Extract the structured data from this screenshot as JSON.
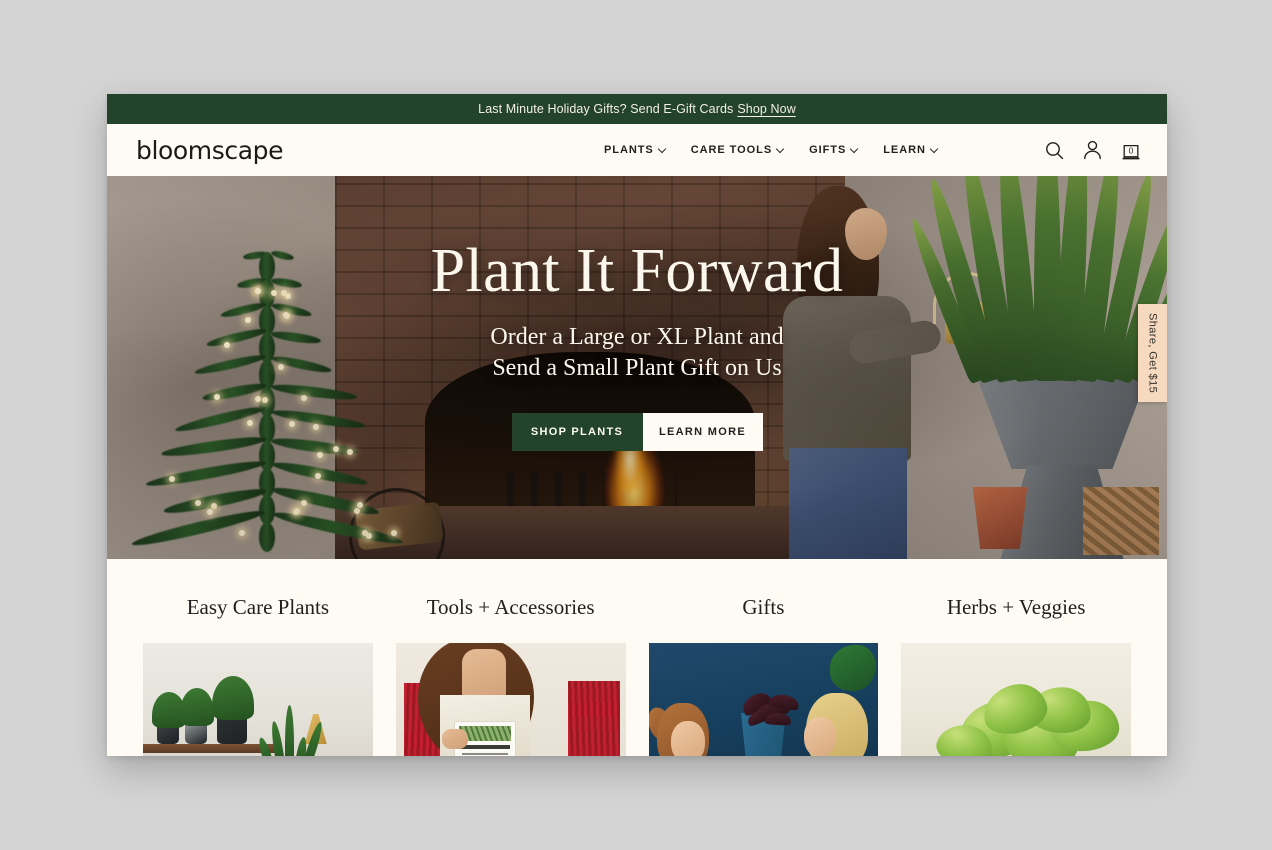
{
  "announcement": {
    "text": "Last Minute Holiday Gifts? Send E-Gift Cards",
    "link_label": "Shop Now"
  },
  "header": {
    "logo": "bloomscape",
    "nav": [
      {
        "label": "PLANTS",
        "has_dropdown": true
      },
      {
        "label": "CARE TOOLS",
        "has_dropdown": true
      },
      {
        "label": "GIFTS",
        "has_dropdown": true
      },
      {
        "label": "LEARN",
        "has_dropdown": true
      }
    ],
    "actions": {
      "search_icon": "search-icon",
      "account_icon": "account-icon",
      "cart_icon": "cart-icon",
      "cart_count": "0"
    }
  },
  "hero": {
    "title": "Plant It Forward",
    "subtitle_line1": "Order a Large or XL Plant and",
    "subtitle_line2": "Send a Small Plant Gift on Us",
    "primary_button": "SHOP PLANTS",
    "secondary_button": "LEARN MORE"
  },
  "share_tab": {
    "label": "Share, Get $15"
  },
  "categories": [
    {
      "title": "Easy Care Plants",
      "image_alt": "plant-shelf-photo"
    },
    {
      "title": "Tools + Accessories",
      "image_alt": "woman-holding-book-photo"
    },
    {
      "title": "Gifts",
      "image_alt": "child-and-woman-with-plant-photo"
    },
    {
      "title": "Herbs + Veggies",
      "image_alt": "basil-leaves-photo"
    }
  ],
  "colors": {
    "page_background": "#d4d4d4",
    "brand_green": "#23432b",
    "cream": "#fdfbf4",
    "share_tab_peach": "#f7d9c0",
    "text_dark": "#1f1f1d"
  }
}
